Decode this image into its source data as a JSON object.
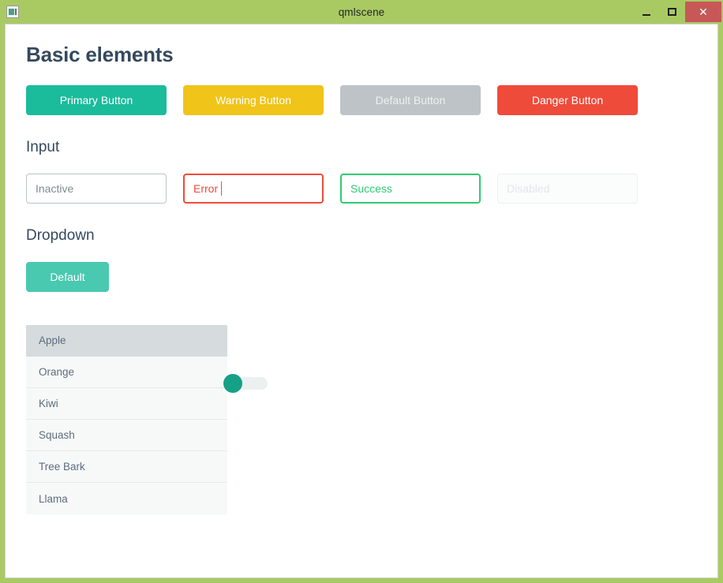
{
  "window": {
    "title": "qmlscene",
    "icon": "app-window-icon",
    "controls": {
      "minimize": "minimize-icon",
      "maximize": "maximize-icon",
      "close": "✕"
    },
    "frame_color": "#a9ca63",
    "close_color": "#c75858"
  },
  "page": {
    "heading": "Basic elements",
    "sections": {
      "input_heading": "Input",
      "dropdown_heading": "Dropdown"
    }
  },
  "buttons": [
    {
      "label": "Primary Button",
      "variant": "primary",
      "color": "#1abc9c"
    },
    {
      "label": "Warning Button",
      "variant": "warning",
      "color": "#f0c419"
    },
    {
      "label": "Default Button",
      "variant": "default",
      "color": "#bdc3c7"
    },
    {
      "label": "Danger Button",
      "variant": "danger",
      "color": "#ef4b3a"
    }
  ],
  "inputs": [
    {
      "value": "Inactive",
      "placeholder": "Inactive",
      "state": "inactive",
      "color": "#bdc3c7"
    },
    {
      "value": "Error",
      "placeholder": "Error",
      "state": "error",
      "color": "#ef4b3a"
    },
    {
      "value": "Success",
      "placeholder": "Success",
      "state": "success",
      "color": "#2ecc71"
    },
    {
      "value": "",
      "placeholder": "Disabled",
      "state": "disabled",
      "color": "#e3e7e8"
    }
  ],
  "dropdown": {
    "button_label": "Default",
    "button_color": "#48c9b0",
    "highlight_index": 0,
    "items": [
      {
        "label": "Apple"
      },
      {
        "label": "Orange"
      },
      {
        "label": "Kiwi"
      },
      {
        "label": "Squash"
      },
      {
        "label": "Tree Bark"
      },
      {
        "label": "Llama"
      }
    ]
  },
  "toggle": {
    "state": "off",
    "handle_color": "#16a085",
    "track_color": "#ecf0f1"
  }
}
